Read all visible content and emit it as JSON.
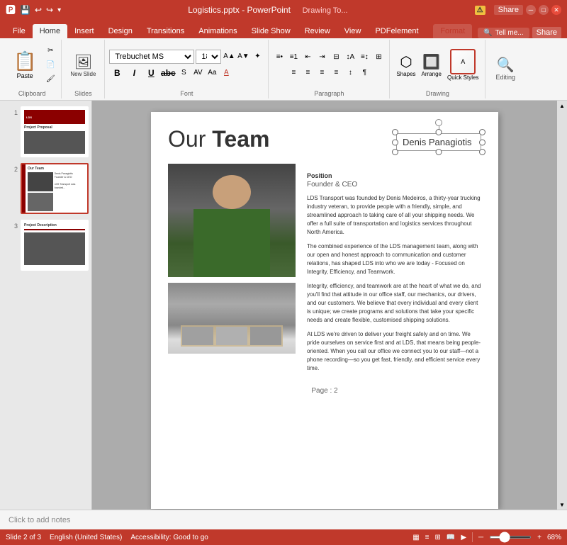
{
  "titlebar": {
    "filename": "Logistics.pptx - PowerPoint",
    "drawing_tools": "Drawing To...",
    "minimize": "─",
    "maximize": "□",
    "close": "✕"
  },
  "quickaccess": {
    "save": "💾",
    "undo": "↩",
    "redo": "↪",
    "more": "▾"
  },
  "tabs": {
    "file": "File",
    "home": "Home",
    "insert": "Insert",
    "design": "Design",
    "transitions": "Transitions",
    "animations": "Animations",
    "slideshow": "Slide Show",
    "review": "Review",
    "view": "View",
    "pdfelement": "PDFelement",
    "format": "Format"
  },
  "ribbon": {
    "paste_label": "Paste",
    "clipboard_label": "Clipboard",
    "new_slide_label": "New\nSlide",
    "slides_label": "Slides",
    "font_name": "Trebuchet MS",
    "font_size": "18",
    "bold": "B",
    "italic": "I",
    "underline": "U",
    "strikethrough": "abc",
    "font_label": "Font",
    "paragraph_label": "Paragraph",
    "drawing_label": "Drawing",
    "shapes_label": "Shapes",
    "arrange_label": "Arrange",
    "quick_styles_label": "Quick\nStyles",
    "editing_label": "Editing"
  },
  "drawing_tools_bar": {
    "label": "Drawing Tools",
    "format_tab": "Format"
  },
  "tell_me": "Tell me...",
  "share": "Share",
  "slides": [
    {
      "number": "1",
      "type": "title",
      "title": "Project Proposal"
    },
    {
      "number": "2",
      "type": "team",
      "title": "Our Team",
      "active": true
    },
    {
      "number": "3",
      "type": "description",
      "title": "Project Description"
    }
  ],
  "slide": {
    "title_our": "Our ",
    "title_team": "Team",
    "name_box": "Denis Panagiotis",
    "position_label": "Position",
    "position_value": "Founder & CEO",
    "text1": "LDS Transport was founded by Denis Medeiros, a thirty-year trucking industry veteran, to provide people with a friendly, simple, and streamlined approach to taking care of all your shipping needs. We offer a full suite of transportation and logistics services throughout North America.",
    "text2": "The combined experience of the LDS management team, along with our open and honest approach to communication and customer relations, has shaped LDS into who we are today - Focused on Integrity, Efficiency, and Teamwork.",
    "text3": "Integrity, efficiency, and teamwork are at the heart of what we do, and you'll find that attitude in our office staff, our mechanics, our drivers, and our customers. We believe that every individual and every client is unique; we create programs and solutions that take your specific needs and create flexible, customised shipping solutions.",
    "text4": "At LDS we're driven to deliver your freight safely and on time. We pride ourselves on service first and at LDS, that means being people-oriented. When you call our office we connect you to our staff—not a phone recording—so you get fast, friendly, and efficient service every time.",
    "page_num": "Page : 2"
  },
  "notes": "Click to add notes",
  "statusbar": {
    "slide_count": "Slide 2 of 3",
    "language": "English (United States)",
    "accessibility": "Accessibility: Good to go",
    "normal_view": "▦",
    "outline_view": "≡",
    "slide_sorter": "⊞",
    "reading_view": "📖",
    "slideshow": "▶",
    "zoom": "68%",
    "zoom_out": "─",
    "zoom_in": "+"
  }
}
